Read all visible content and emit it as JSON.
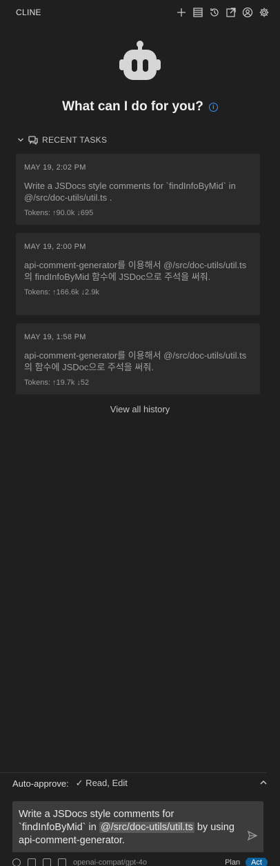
{
  "header": {
    "title": "CLINE"
  },
  "welcome": {
    "heading": "What can I do for you?"
  },
  "recent": {
    "title": "RECENT TASKS",
    "tasks": [
      {
        "date": "MAY 19, 2:02 PM",
        "text": "Write a JSDocs style comments for `findInfoByMid` in @/src/doc-utils/util.ts .",
        "tokens": "Tokens: ↑90.0k ↓695"
      },
      {
        "date": "MAY 19, 2:00 PM",
        "text": "api-comment-generator를 이용해서 @/src/doc-utils/util.ts 의 findInfoByMid 함수에 JSDoc으로 주석을 써줘.",
        "tokens": "Tokens: ↑166.6k ↓2.9k"
      },
      {
        "date": "MAY 19, 1:58 PM",
        "text": "api-comment-generator를 이용해서 @/src/doc-utils/util.ts 의 함수에 JSDoc으로 주석을 써줘.",
        "tokens": "Tokens: ↑19.7k ↓52"
      }
    ],
    "view_all": "View all history"
  },
  "auto_approve": {
    "label": "Auto-approve:",
    "value": "✓ Read, Edit"
  },
  "input": {
    "before": "Write a JSDocs style comments for `findInfoByMid` in ",
    "mention": "@/src/doc-utils/util.ts",
    "after": "  by using api-comment-generator."
  },
  "footer": {
    "model": "openai-compat/gpt-4o",
    "plan": "Plan",
    "act": "Act"
  }
}
